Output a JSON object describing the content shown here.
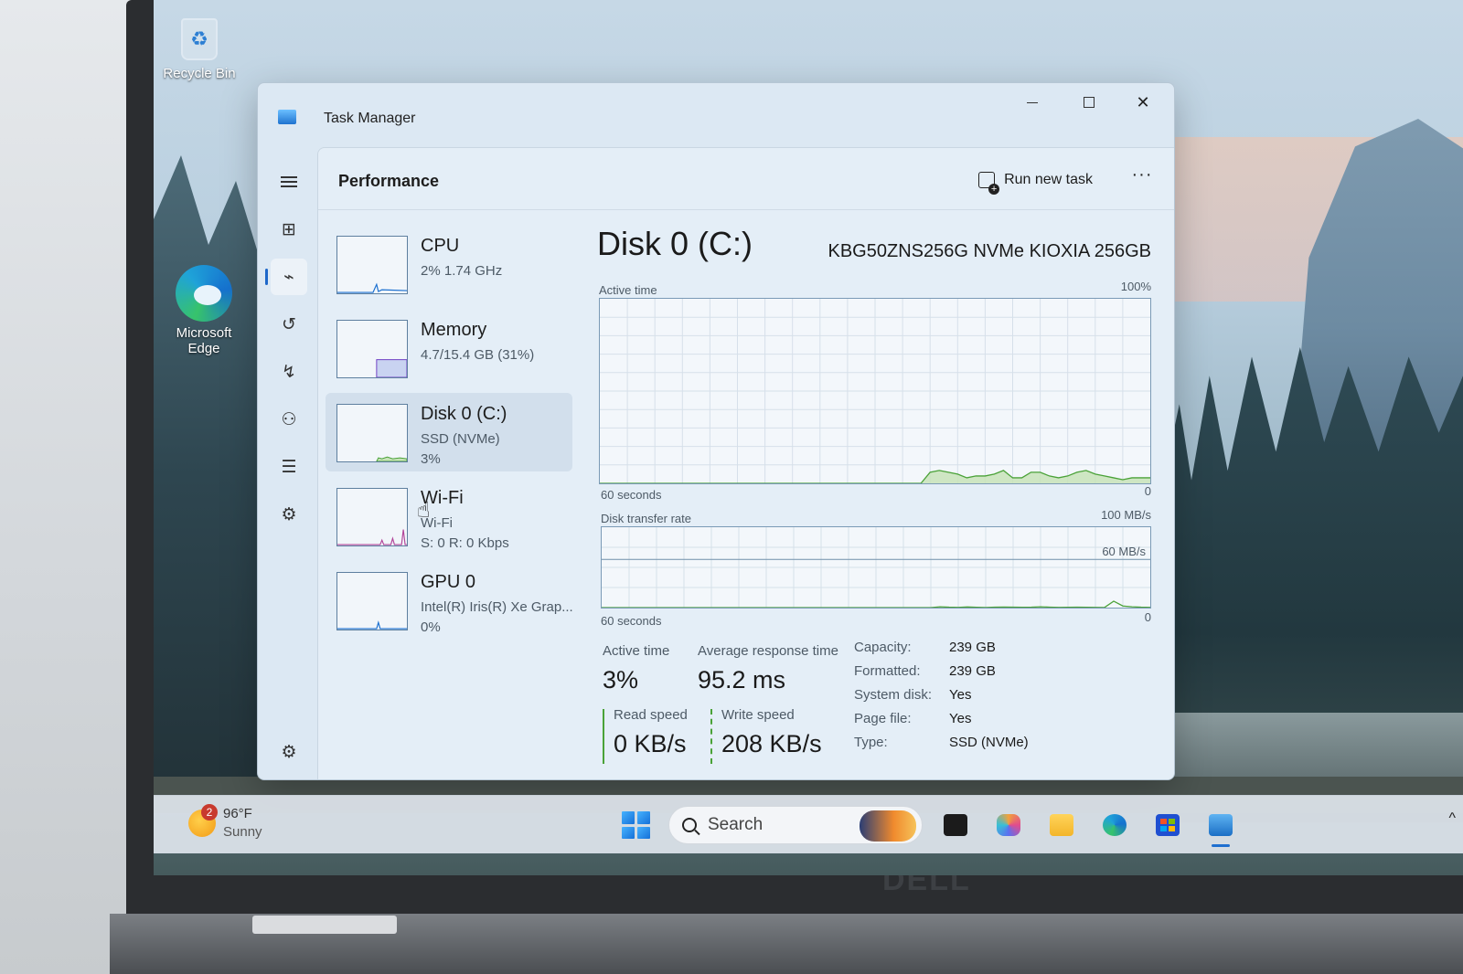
{
  "desktop": {
    "icons": [
      {
        "label": "Recycle Bin",
        "icon": "recycle-bin-icon"
      },
      {
        "label": "Microsoft Edge",
        "icon": "edge-icon"
      }
    ]
  },
  "laptop": {
    "brand": "DELL"
  },
  "taskbar": {
    "weather": {
      "temp": "96°F",
      "condition": "Sunny",
      "badge": "2",
      "icon": "sun-icon"
    },
    "search_text": "Search",
    "apps": [
      "start-icon",
      "task-view-icon",
      "copilot-icon",
      "file-explorer-icon",
      "edge-icon",
      "store-icon",
      "task-manager-icon"
    ],
    "chevron": "^"
  },
  "window": {
    "title": "Task Manager",
    "controls": {
      "minimize": "–",
      "maximize": "□",
      "close": "✕"
    }
  },
  "nav": {
    "items": [
      {
        "icon": "hamburger-icon"
      },
      {
        "icon": "processes-icon"
      },
      {
        "icon": "performance-icon",
        "active": true
      },
      {
        "icon": "app-history-icon"
      },
      {
        "icon": "startup-apps-icon"
      },
      {
        "icon": "users-icon"
      },
      {
        "icon": "details-icon"
      },
      {
        "icon": "services-icon"
      }
    ],
    "settings_icon": "settings-icon"
  },
  "header": {
    "title": "Performance",
    "run_new_task": "Run new task",
    "more": "···"
  },
  "devices": [
    {
      "name": "CPU",
      "sub1": "2% 1.74 GHz",
      "sub2": "",
      "usage": 2,
      "color": "#1a6fd0"
    },
    {
      "name": "Memory",
      "sub1": "4.7/15.4 GB (31%)",
      "sub2": "",
      "usage": 31,
      "color": "#6f3fc4"
    },
    {
      "name": "Disk 0 (C:)",
      "sub1": "SSD (NVMe)",
      "sub2": "3%",
      "usage": 3,
      "color": "#4aa238",
      "active": true
    },
    {
      "name": "Wi-Fi",
      "sub1": "Wi-Fi",
      "sub2": "S: 0 R: 0 Kbps",
      "usage": 0,
      "color": "#b2459a"
    },
    {
      "name": "GPU 0",
      "sub1": "Intel(R) Iris(R) Xe Grap...",
      "sub2": "0%",
      "usage": 0,
      "color": "#1a6fd0"
    }
  ],
  "detail": {
    "title": "Disk 0 (C:)",
    "model": "KBG50ZNS256G NVMe KIOXIA 256GB",
    "active_chart": {
      "label": "Active time",
      "max_label": "100%",
      "time_label": "60 seconds",
      "min_label": "0"
    },
    "transfer_chart": {
      "label": "Disk transfer rate",
      "max_label": "100 MB/s",
      "mid_label": "60 MB/s",
      "time_label": "60 seconds",
      "min_label": "0"
    },
    "stats": {
      "active_time": {
        "label": "Active time",
        "value": "3%"
      },
      "avg_response": {
        "label": "Average response time",
        "value": "95.2 ms"
      },
      "read_speed": {
        "label": "Read speed",
        "value": "0 KB/s"
      },
      "write_speed": {
        "label": "Write speed",
        "value": "208 KB/s"
      }
    },
    "properties": [
      {
        "key": "Capacity:",
        "value": "239 GB"
      },
      {
        "key": "Formatted:",
        "value": "239 GB"
      },
      {
        "key": "System disk:",
        "value": "Yes"
      },
      {
        "key": "Page file:",
        "value": "Yes"
      },
      {
        "key": "Type:",
        "value": "SSD (NVMe)"
      }
    ]
  },
  "colors": {
    "disk_line": "#4aa238",
    "disk_fill": "#c7e3b8",
    "accent": "#1d67c9",
    "grid": "#d6e0ea"
  },
  "chart_data": [
    {
      "type": "area",
      "title": "Active time",
      "xlabel": "60 seconds",
      "ylim": [
        0,
        100
      ],
      "x": [
        0,
        5,
        10,
        15,
        20,
        25,
        30,
        35,
        36,
        37,
        38,
        39,
        40,
        41,
        42,
        43,
        44,
        45,
        46,
        47,
        48,
        49,
        50,
        51,
        52,
        53,
        54,
        55,
        56,
        57,
        58,
        59,
        60
      ],
      "values": [
        0,
        0,
        0,
        0,
        0,
        0,
        0,
        0,
        6,
        7,
        6,
        5,
        3,
        4,
        4,
        5,
        7,
        3,
        3,
        6,
        6,
        4,
        3,
        4,
        6,
        7,
        5,
        4,
        3,
        2,
        3,
        3,
        3
      ]
    },
    {
      "type": "line",
      "title": "Disk transfer rate",
      "xlabel": "60 seconds",
      "ylim": [
        0,
        100
      ],
      "x": [
        0,
        5,
        10,
        15,
        20,
        25,
        30,
        35,
        36,
        37,
        38,
        39,
        40,
        41,
        42,
        43,
        44,
        45,
        46,
        47,
        48,
        49,
        50,
        51,
        52,
        53,
        54,
        55,
        56,
        57,
        58,
        59,
        60
      ],
      "values": [
        0,
        0,
        0,
        0,
        0,
        0,
        0,
        0,
        0,
        1,
        0.5,
        0.3,
        0.8,
        0.4,
        0.2,
        0.6,
        0.7,
        0.5,
        0.4,
        0.5,
        1,
        0.6,
        0.3,
        0.4,
        0.5,
        0.4,
        0.3,
        0.2,
        8,
        2,
        1,
        0.5,
        0.3
      ]
    }
  ]
}
